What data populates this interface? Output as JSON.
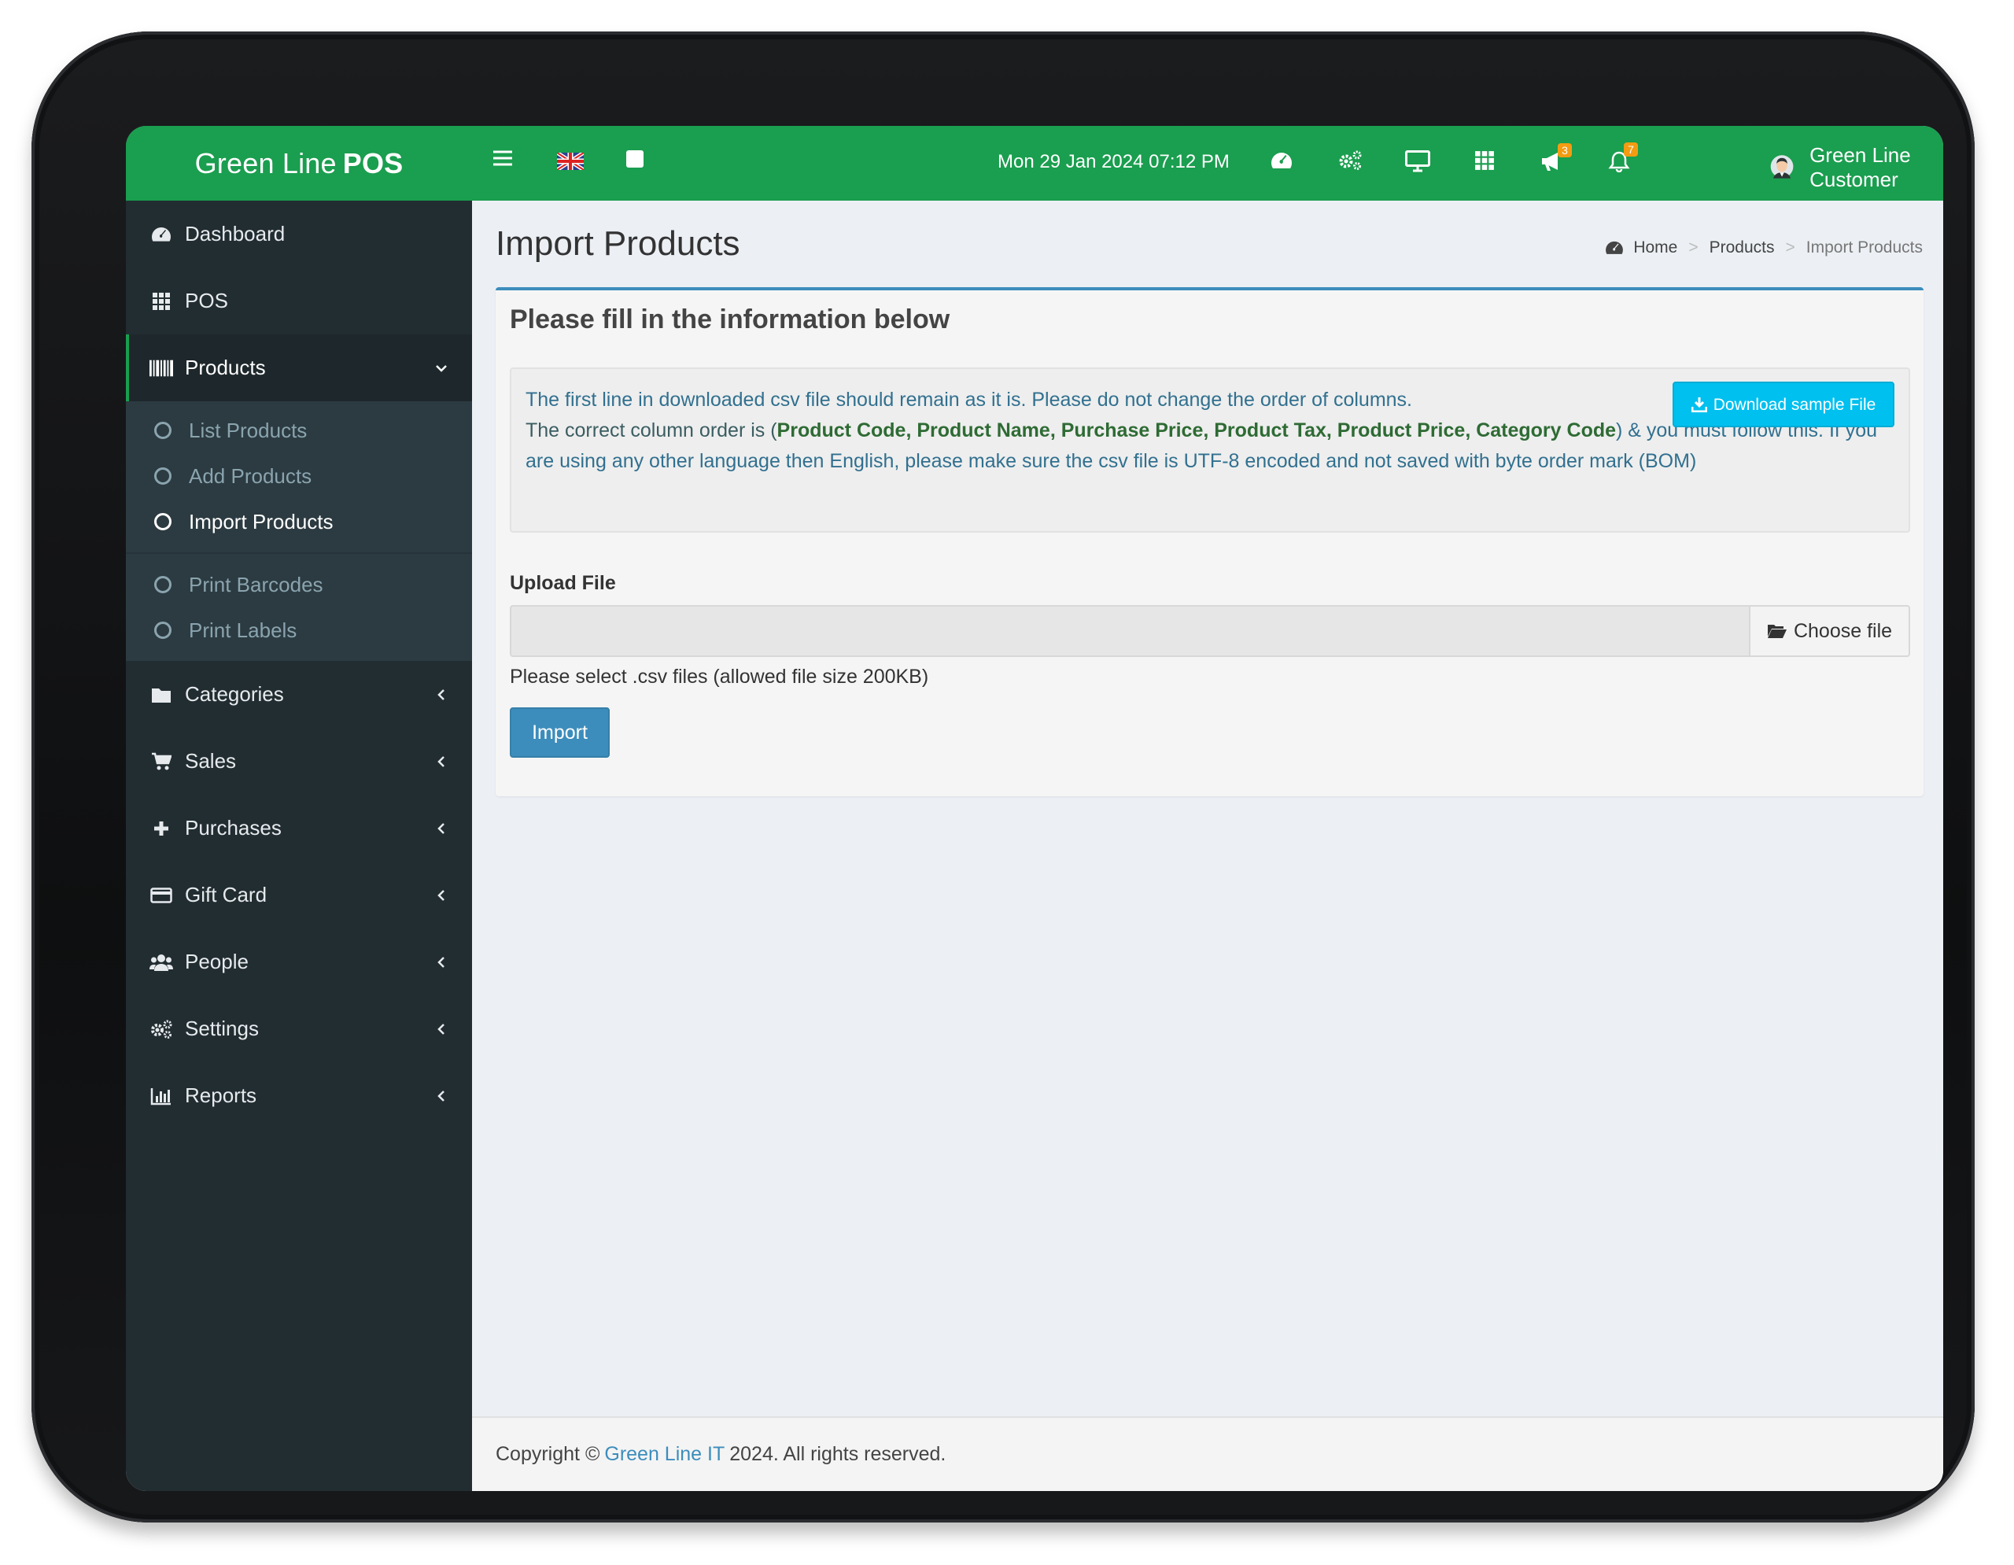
{
  "brand": {
    "name_regular": "Green Line",
    "name_bold": "POS",
    "color": "#1a9e4f"
  },
  "topbar": {
    "datetime": "Mon 29 Jan 2024 07:12 PM",
    "announcements_badge": "3",
    "notifications_badge": "7",
    "user_name": "Green Line Customer",
    "icons": [
      "menu-icon",
      "uk-flag-icon",
      "square-icon",
      "dashboard-icon",
      "settings-icon",
      "monitor-icon",
      "grid-icon",
      "bullhorn-icon",
      "bell-icon"
    ]
  },
  "sidebar": {
    "items": [
      {
        "label": "Dashboard",
        "icon": "dashboard-icon"
      },
      {
        "label": "POS",
        "icon": "grid-icon"
      },
      {
        "label": "Products",
        "icon": "barcode-icon",
        "expanded": true
      },
      {
        "label": "Categories",
        "icon": "folder-icon"
      },
      {
        "label": "Sales",
        "icon": "cart-icon"
      },
      {
        "label": "Purchases",
        "icon": "plus-icon"
      },
      {
        "label": "Gift Card",
        "icon": "credit-card-icon"
      },
      {
        "label": "People",
        "icon": "users-icon"
      },
      {
        "label": "Settings",
        "icon": "cogs-icon"
      },
      {
        "label": "Reports",
        "icon": "bar-chart-icon"
      }
    ],
    "products_sub": [
      "List Products",
      "Add Products",
      "Import Products"
    ],
    "products_sub2": [
      "Print Barcodes",
      "Print Labels"
    ]
  },
  "page": {
    "title": "Import Products",
    "breadcrumb": [
      "Home",
      "Products",
      "Import Products"
    ]
  },
  "form": {
    "title": "Please fill in the information below",
    "info_line1": "The first line in downloaded csv file should remain as it is. Please do not change the order of columns.",
    "info_line2_prefix": "The correct column order is (",
    "info_columns": "Product Code, Product Name, Purchase Price, Product Tax, Product Price, Category Code",
    "info_line2_suffix": ") & you must follow this. If you are using any other language then English, please make sure the csv file is UTF-8 encoded and not saved with byte order mark (BOM)",
    "download_label": "Download sample File",
    "upload_label": "Upload File",
    "choose_label": "Choose file",
    "file_value": "",
    "help_text": "Please select .csv files (allowed file size 200KB)",
    "import_label": "Import"
  },
  "footer": {
    "prefix": "Copyright ©",
    "link": "Green Line IT",
    "suffix": "2024. All rights reserved."
  }
}
